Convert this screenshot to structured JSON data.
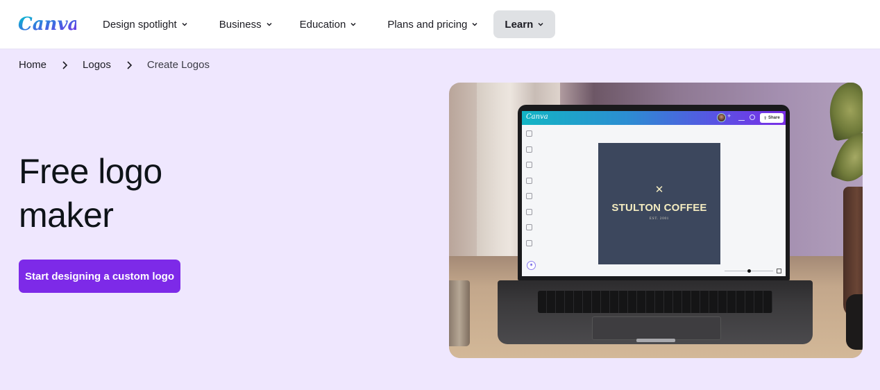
{
  "brand": {
    "name": "Canva",
    "logo_gradient": [
      "#00c4cc",
      "#7d2ae8"
    ]
  },
  "nav": {
    "items": [
      {
        "label": "Design spotlight",
        "icon": "chevron-down-icon",
        "active": false
      },
      {
        "label": "Business",
        "icon": "chevron-down-icon",
        "active": false
      },
      {
        "label": "Education",
        "icon": "chevron-down-icon",
        "active": false
      },
      {
        "label": "Plans and pricing",
        "icon": "chevron-down-icon",
        "active": false
      },
      {
        "label": "Learn",
        "icon": "chevron-down-icon",
        "active": true
      }
    ]
  },
  "breadcrumb": {
    "items": [
      "Home",
      "Logos",
      "Create Logos"
    ],
    "separator_icon": "chevron-right-icon"
  },
  "hero": {
    "title_line1": "Free logo",
    "title_line2": "maker",
    "cta_label": "Start designing a custom logo",
    "accent_color": "#7d2ae8",
    "background_color": "#efe7fe"
  },
  "hero_image": {
    "description": "Laptop on a desk showing the Canva editor with a logo design",
    "editor": {
      "logo": "Canva",
      "share_label": "Share",
      "plus_label": "+",
      "design": {
        "icon": "crossed-utensils-icon",
        "icon_glyph": "✕",
        "title": "STULTON COFFEE",
        "subtitle": "EST. 2001"
      }
    }
  }
}
